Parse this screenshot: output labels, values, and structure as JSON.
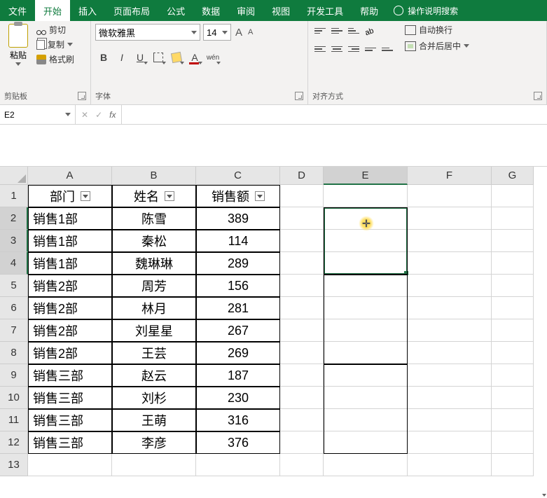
{
  "tabs": [
    "文件",
    "开始",
    "插入",
    "页面布局",
    "公式",
    "数据",
    "审阅",
    "视图",
    "开发工具",
    "帮助"
  ],
  "tellMe": "操作说明搜索",
  "clipboard": {
    "paste": "粘贴",
    "cut": "剪切",
    "copy": "复制",
    "formatPainter": "格式刷",
    "groupLabel": "剪贴板"
  },
  "font": {
    "name": "微软雅黑",
    "size": "14",
    "groupLabel": "字体",
    "increase": "A",
    "decrease": "A",
    "bold": "B",
    "italic": "I",
    "underline": "U",
    "fontColorLetter": "A",
    "phonetic": "wén"
  },
  "align": {
    "groupLabel": "对齐方式",
    "wrap": "自动换行",
    "merge": "合并后居中"
  },
  "nameBox": "E2",
  "colHeaders": [
    "A",
    "B",
    "C",
    "D",
    "E",
    "F",
    "G"
  ],
  "rowHeaders": [
    "1",
    "2",
    "3",
    "4",
    "5",
    "6",
    "7",
    "8",
    "9",
    "10",
    "11",
    "12",
    "13"
  ],
  "tableHeaders": [
    "部门",
    "姓名",
    "销售额"
  ],
  "rows": [
    [
      "销售1部",
      "陈雪",
      "389"
    ],
    [
      "销售1部",
      "秦松",
      "114"
    ],
    [
      "销售1部",
      "魏琳琳",
      "289"
    ],
    [
      "销售2部",
      "周芳",
      "156"
    ],
    [
      "销售2部",
      "林月",
      "281"
    ],
    [
      "销售2部",
      "刘星星",
      "267"
    ],
    [
      "销售2部",
      "王芸",
      "269"
    ],
    [
      "销售三部",
      "赵云",
      "187"
    ],
    [
      "销售三部",
      "刘杉",
      "230"
    ],
    [
      "销售三部",
      "王萌",
      "316"
    ],
    [
      "销售三部",
      "李彦",
      "376"
    ]
  ]
}
